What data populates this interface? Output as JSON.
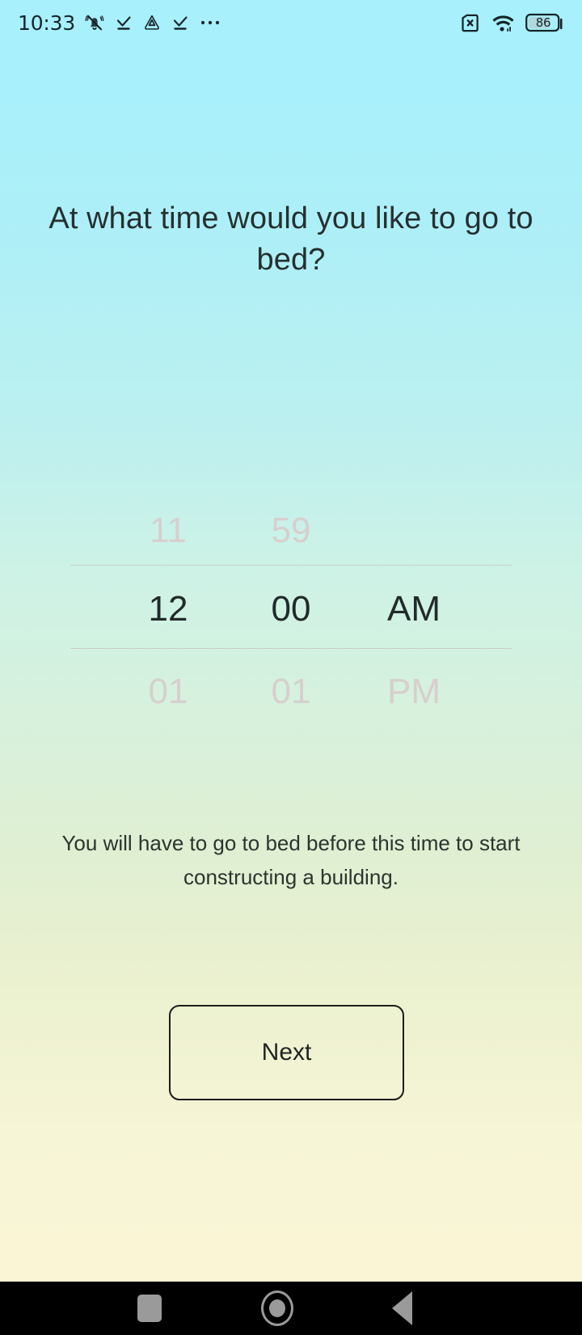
{
  "status_bar": {
    "clock": "10:33",
    "battery_level": "86",
    "left_icons": [
      {
        "name": "bell-muted-icon"
      },
      {
        "name": "download-check-icon"
      },
      {
        "name": "triangle-app-icon"
      },
      {
        "name": "download-check-icon-2"
      },
      {
        "name": "more-dots-icon"
      }
    ],
    "right_icons": [
      {
        "name": "sim-card-disabled-icon"
      },
      {
        "name": "wifi-icon"
      },
      {
        "name": "battery-icon"
      }
    ]
  },
  "screen": {
    "title": "At what time would you like to go to bed?",
    "description": "You will have to go to bed before this time to start constructing a building.",
    "next_label": "Next"
  },
  "time_picker": {
    "previous": {
      "hour": "11",
      "minute": "59",
      "period": ""
    },
    "selected": {
      "hour": "12",
      "minute": "00",
      "period": "AM"
    },
    "next": {
      "hour": "01",
      "minute": "01",
      "period": "PM"
    }
  },
  "nav_bar": {
    "recents_label": "recents",
    "home_label": "home",
    "back_label": "back"
  },
  "colors": {
    "gradient_top": "#a8f0fb",
    "gradient_bottom": "#faf5d5",
    "text_primary": "#26302f",
    "picker_faded": "#d7cfcd",
    "nav_icon": "#9a9a9a"
  }
}
